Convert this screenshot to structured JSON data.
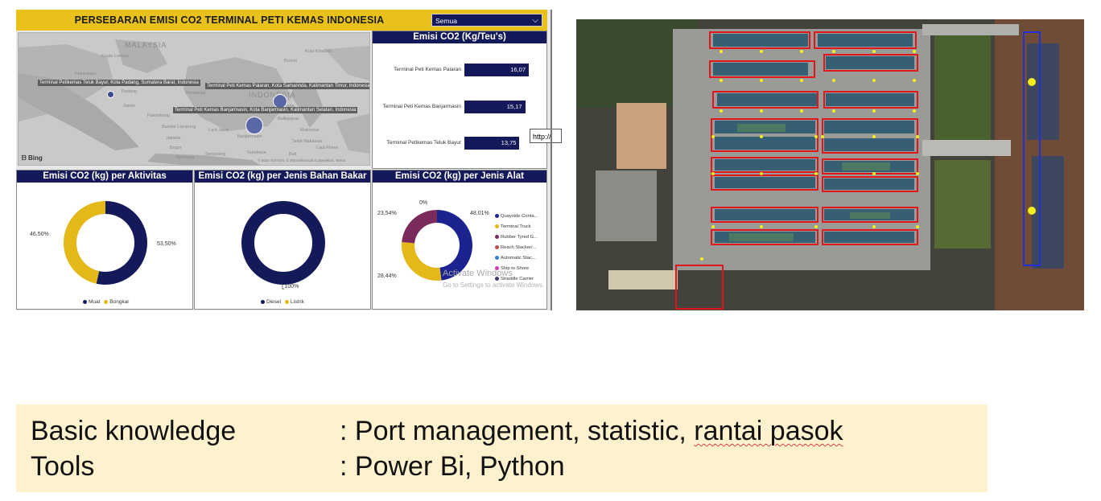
{
  "dashboard": {
    "title": "PERSEBARAN EMISI CO2 TERMINAL PETI KEMAS INDONESIA",
    "slicer_value": "Semua",
    "map": {
      "countries": [
        "MALAYSIA",
        "INDONESIA"
      ],
      "callouts": [
        "Terminal Petikemas Teluk Bayur, Kota Padang, Sumatera Barat, Indonesia",
        "Terminal Peti Kemas Palaran, Kota Samarinda, Kalimantan Timur, Indonesia",
        "Terminal Peti Kemas Banjarmasin, Kota Banjarmasin, Kalimantan Selatan, Indonesia"
      ],
      "cities": [
        "Kuala Lumpur",
        "Pekanbaru",
        "Padang",
        "Pontianak",
        "Palembang",
        "Jambi",
        "Bandar Lampung",
        "Jakarta",
        "Bogor",
        "Bandung",
        "Semarang",
        "Surabaya",
        "Banjarmasin",
        "Balikpapan",
        "Samarinda",
        "Makassar",
        "Bali",
        "Laut Jawa",
        "Selat Makassar",
        "Laut Flores",
        "Kota Kinabalu",
        "Brunei"
      ],
      "provider": "Bing",
      "copyright": "© 2024 TomTom, © 2024 Microsoft Corporation, Terms"
    },
    "teu_panel": {
      "title": "Emisi CO2 (Kg/Teu's)",
      "bars": [
        {
          "label": "Terminal Peti Kemas Palaran",
          "value": "16,07",
          "num": 16.07
        },
        {
          "label": "Terminal Peti Kemas Banjarmasin",
          "value": "15,17",
          "num": 15.17
        },
        {
          "label": "Terminal Petikemas Teluk Bayur",
          "value": "13,75",
          "num": 13.75
        }
      ],
      "tooltip": "http://"
    },
    "aktivitas_panel": {
      "title": "Emisi CO2 (kg) per Aktivitas",
      "slices": [
        {
          "name": "Muat",
          "percent": 53.5,
          "label": "53,50%",
          "color": "#14195a"
        },
        {
          "name": "Bongkar",
          "percent": 46.5,
          "label": "46,50%",
          "color": "#e5b819"
        }
      ]
    },
    "bahan_panel": {
      "title": "Emisi CO2 (kg) per Jenis Bahan Bakar",
      "slices": [
        {
          "name": "Diesel",
          "percent": 100,
          "label": "100%",
          "color": "#14195a"
        },
        {
          "name": "Listrik",
          "percent": 0,
          "label": "",
          "color": "#e5b819"
        }
      ]
    },
    "alat_panel": {
      "title": "Emisi CO2 (kg) per Jenis Alat",
      "slices": [
        {
          "name": "Quayside Conta...",
          "percent": 48.01,
          "label": "48,01%",
          "color": "#1c2391"
        },
        {
          "name": "Terminal Truck",
          "percent": 28.44,
          "label": "28,44%",
          "color": "#e5b819"
        },
        {
          "name": "Rubber Tyred G...",
          "percent": 23.54,
          "label": "23,54%",
          "color": "#7b2a5c"
        },
        {
          "name": "Reach Stacker/...",
          "percent": 0,
          "label": "0%",
          "color": "#c0504d"
        },
        {
          "name": "Automatic Stac...",
          "percent": 0,
          "label": "",
          "color": "#2e7fd1"
        },
        {
          "name": "Ship to Shore",
          "percent": 0,
          "label": "",
          "color": "#d63ab8"
        },
        {
          "name": "Straddle Carrier",
          "percent": 0,
          "label": "",
          "color": "#3b3b6b"
        }
      ]
    },
    "watermark": {
      "line1": "Activate Windows",
      "line2": "Go to Settings to activate Windows."
    }
  },
  "info": {
    "row1_label": "Basic knowledge",
    "row1_value_a": ": Port management, statistic, ",
    "row1_value_b": "rantai pasok",
    "row2_label": "Tools",
    "row2_value": ": Power Bi, Python"
  },
  "colors": {
    "navy": "#14195a",
    "gold": "#e5b819",
    "info_bg": "#fdf1ce"
  }
}
